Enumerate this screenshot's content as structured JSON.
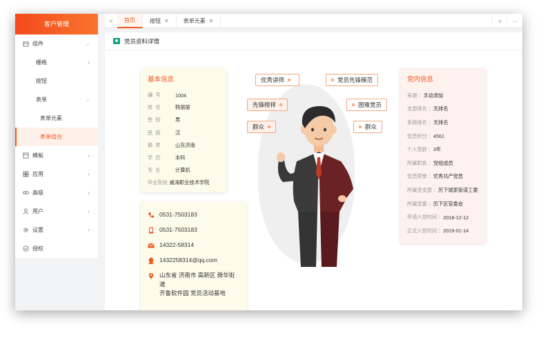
{
  "sidebar": {
    "title": "客户管理",
    "items": [
      {
        "label": "组件",
        "level": 1,
        "icon": "box-icon",
        "arrow": "chevron-down"
      },
      {
        "label": "栅格",
        "level": 2,
        "arrow": "chevron-left"
      },
      {
        "label": "按钮",
        "level": 2
      },
      {
        "label": "表单",
        "level": 2,
        "arrow": "chevron-down"
      },
      {
        "label": "表单元素",
        "level": 3
      },
      {
        "label": "表单组合",
        "level": 3,
        "active": true
      },
      {
        "label": "模板",
        "level": 1,
        "icon": "template-icon",
        "arrow": "chevron-left"
      },
      {
        "label": "应用",
        "level": 1,
        "icon": "app-icon",
        "arrow": "chevron-left"
      },
      {
        "label": "高级",
        "level": 1,
        "icon": "link-icon",
        "arrow": "chevron-left"
      },
      {
        "label": "用户",
        "level": 1,
        "icon": "user-icon",
        "arrow": "chevron-left"
      },
      {
        "label": "设置",
        "level": 1,
        "icon": "gear-icon",
        "arrow": "chevron-left"
      },
      {
        "label": "授权",
        "level": 1,
        "icon": "shield-icon"
      }
    ]
  },
  "tabs": [
    {
      "label": "首页",
      "active": true,
      "closable": false
    },
    {
      "label": "按钮",
      "closable": true
    },
    {
      "label": "表单元素",
      "closable": true
    }
  ],
  "panel": {
    "title": "党员资料详情"
  },
  "basic_info": {
    "title": "基本信息",
    "rows": [
      {
        "key": "编号",
        "value": "1004"
      },
      {
        "key": "姓名",
        "value": "韩丽丽"
      },
      {
        "key": "性别",
        "value": "男"
      },
      {
        "key": "民族",
        "value": "汉"
      },
      {
        "key": "籍贯",
        "value": "山东济南"
      },
      {
        "key": "学历",
        "value": "本科"
      },
      {
        "key": "专业",
        "value": "计算机"
      },
      {
        "key": "毕业院校",
        "value": "威海职业技术学院"
      }
    ]
  },
  "party_info": {
    "title": "党内信息",
    "rows": [
      {
        "key": "来源",
        "value": "手动添加"
      },
      {
        "key": "支部排名",
        "value": "无排名"
      },
      {
        "key": "系统排名",
        "value": "无排名"
      },
      {
        "key": "党员积分",
        "value": "4561"
      },
      {
        "key": "个人党龄",
        "value": "3年"
      },
      {
        "key": "所属职务",
        "value": "党组成员"
      },
      {
        "key": "党员荣誉",
        "value": "优秀共产党员"
      },
      {
        "key": "所属党支部",
        "value": "历下城家街道工委"
      },
      {
        "key": "所属党委",
        "value": "历下区管委会"
      },
      {
        "key": "申请入党时间",
        "value": "2018-12-12"
      },
      {
        "key": "正式入党时间",
        "value": "2019-01-14"
      }
    ]
  },
  "contact": {
    "phone": "0531-7503183",
    "mobile": "0531-7503183",
    "fax": "14322-58314",
    "qq": "1432258314@qq.com",
    "address_line1": "山东省 济南市 高新区 舜华街道",
    "address_line2": "齐鲁软件园 党员活动基地"
  },
  "tags": {
    "excellent_lecturer": "优秀讲师",
    "pioneer_model": "党员先锋模范",
    "pioneer_example": "先锋榜样",
    "needy_member": "困难党员",
    "masses_left": "群众",
    "masses_right": "群众"
  },
  "colors": {
    "accent": "#f2581f",
    "tag_border": "#f2a67f"
  }
}
